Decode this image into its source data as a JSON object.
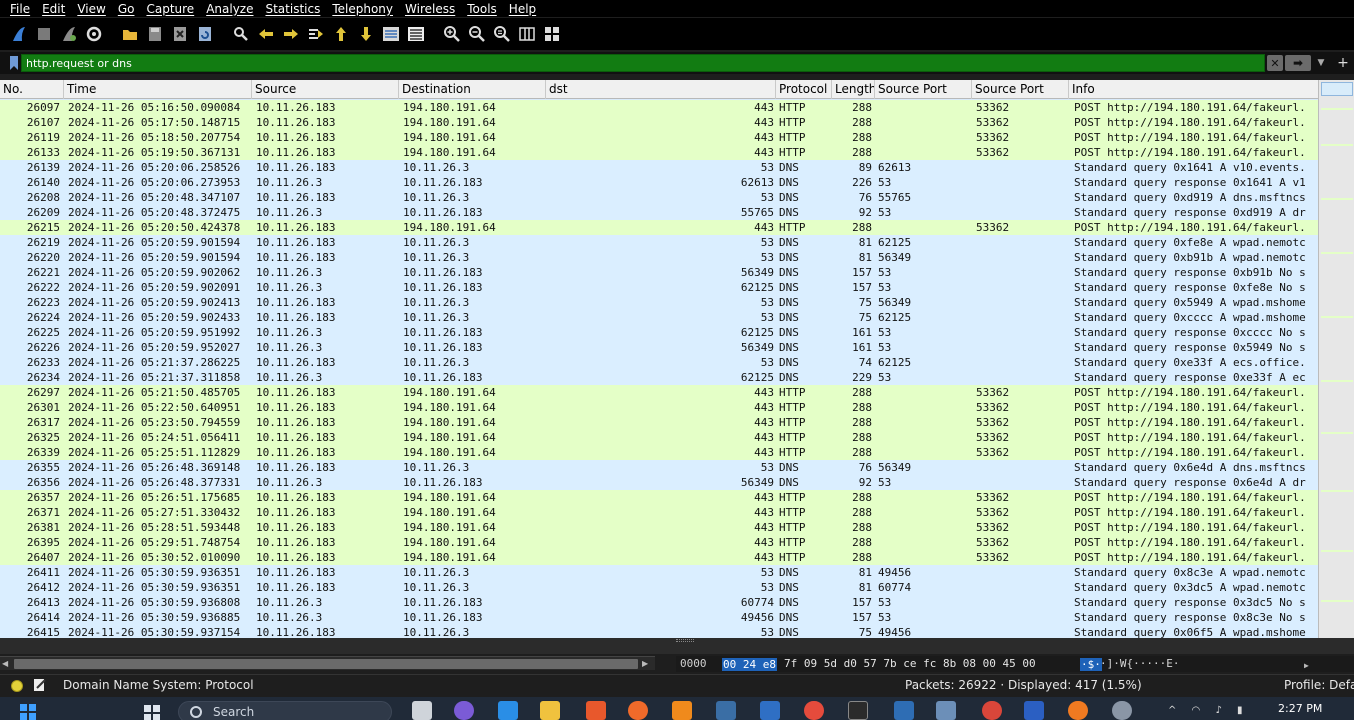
{
  "menu": [
    "File",
    "Edit",
    "View",
    "Go",
    "Capture",
    "Analyze",
    "Statistics",
    "Telephony",
    "Wireless",
    "Tools",
    "Help"
  ],
  "filter": {
    "value": "http.request or dns"
  },
  "columns": [
    "No.",
    "Time",
    "Source",
    "Destination",
    "dst",
    "Protocol",
    "Length",
    "Source Port",
    "Source Port",
    "Info"
  ],
  "colors": {
    "http_row": "#e4ffc7",
    "dns_row": "#daeeff",
    "filter_valid": "#127c12",
    "selection": "#1e62b8"
  },
  "rows": [
    {
      "no": "26097",
      "time": "2024-11-26 05:16:50.090084",
      "src": "10.11.26.183",
      "dst": "194.180.191.64",
      "dport": "443",
      "proto": "HTTP",
      "len": "288",
      "sport1": "",
      "sport2": "53362",
      "info": "POST http://194.180.191.64/fakeurl."
    },
    {
      "no": "26107",
      "time": "2024-11-26 05:17:50.148715",
      "src": "10.11.26.183",
      "dst": "194.180.191.64",
      "dport": "443",
      "proto": "HTTP",
      "len": "288",
      "sport1": "",
      "sport2": "53362",
      "info": "POST http://194.180.191.64/fakeurl."
    },
    {
      "no": "26119",
      "time": "2024-11-26 05:18:50.207754",
      "src": "10.11.26.183",
      "dst": "194.180.191.64",
      "dport": "443",
      "proto": "HTTP",
      "len": "288",
      "sport1": "",
      "sport2": "53362",
      "info": "POST http://194.180.191.64/fakeurl."
    },
    {
      "no": "26133",
      "time": "2024-11-26 05:19:50.367131",
      "src": "10.11.26.183",
      "dst": "194.180.191.64",
      "dport": "443",
      "proto": "HTTP",
      "len": "288",
      "sport1": "",
      "sport2": "53362",
      "info": "POST http://194.180.191.64/fakeurl."
    },
    {
      "no": "26139",
      "time": "2024-11-26 05:20:06.258526",
      "src": "10.11.26.183",
      "dst": "10.11.26.3",
      "dport": "53",
      "proto": "DNS",
      "len": "89",
      "sport1": "62613",
      "sport2": "",
      "info": "Standard query 0x1641 A v10.events."
    },
    {
      "no": "26140",
      "time": "2024-11-26 05:20:06.273953",
      "src": "10.11.26.3",
      "dst": "10.11.26.183",
      "dport": "62613",
      "proto": "DNS",
      "len": "226",
      "sport1": "53",
      "sport2": "",
      "info": "Standard query response 0x1641 A v1"
    },
    {
      "no": "26208",
      "time": "2024-11-26 05:20:48.347107",
      "src": "10.11.26.183",
      "dst": "10.11.26.3",
      "dport": "53",
      "proto": "DNS",
      "len": "76",
      "sport1": "55765",
      "sport2": "",
      "info": "Standard query 0xd919 A dns.msftncs"
    },
    {
      "no": "26209",
      "time": "2024-11-26 05:20:48.372475",
      "src": "10.11.26.3",
      "dst": "10.11.26.183",
      "dport": "55765",
      "proto": "DNS",
      "len": "92",
      "sport1": "53",
      "sport2": "",
      "info": "Standard query response 0xd919 A dr"
    },
    {
      "no": "26215",
      "time": "2024-11-26 05:20:50.424378",
      "src": "10.11.26.183",
      "dst": "194.180.191.64",
      "dport": "443",
      "proto": "HTTP",
      "len": "288",
      "sport1": "",
      "sport2": "53362",
      "info": "POST http://194.180.191.64/fakeurl."
    },
    {
      "no": "26219",
      "time": "2024-11-26 05:20:59.901594",
      "src": "10.11.26.183",
      "dst": "10.11.26.3",
      "dport": "53",
      "proto": "DNS",
      "len": "81",
      "sport1": "62125",
      "sport2": "",
      "info": "Standard query 0xfe8e A wpad.nemotc"
    },
    {
      "no": "26220",
      "time": "2024-11-26 05:20:59.901594",
      "src": "10.11.26.183",
      "dst": "10.11.26.3",
      "dport": "53",
      "proto": "DNS",
      "len": "81",
      "sport1": "56349",
      "sport2": "",
      "info": "Standard query 0xb91b A wpad.nemotc"
    },
    {
      "no": "26221",
      "time": "2024-11-26 05:20:59.902062",
      "src": "10.11.26.3",
      "dst": "10.11.26.183",
      "dport": "56349",
      "proto": "DNS",
      "len": "157",
      "sport1": "53",
      "sport2": "",
      "info": "Standard query response 0xb91b No s"
    },
    {
      "no": "26222",
      "time": "2024-11-26 05:20:59.902091",
      "src": "10.11.26.3",
      "dst": "10.11.26.183",
      "dport": "62125",
      "proto": "DNS",
      "len": "157",
      "sport1": "53",
      "sport2": "",
      "info": "Standard query response 0xfe8e No s"
    },
    {
      "no": "26223",
      "time": "2024-11-26 05:20:59.902413",
      "src": "10.11.26.183",
      "dst": "10.11.26.3",
      "dport": "53",
      "proto": "DNS",
      "len": "75",
      "sport1": "56349",
      "sport2": "",
      "info": "Standard query 0x5949 A wpad.mshome"
    },
    {
      "no": "26224",
      "time": "2024-11-26 05:20:59.902433",
      "src": "10.11.26.183",
      "dst": "10.11.26.3",
      "dport": "53",
      "proto": "DNS",
      "len": "75",
      "sport1": "62125",
      "sport2": "",
      "info": "Standard query 0xcccc A wpad.mshome"
    },
    {
      "no": "26225",
      "time": "2024-11-26 05:20:59.951992",
      "src": "10.11.26.3",
      "dst": "10.11.26.183",
      "dport": "62125",
      "proto": "DNS",
      "len": "161",
      "sport1": "53",
      "sport2": "",
      "info": "Standard query response 0xcccc No s"
    },
    {
      "no": "26226",
      "time": "2024-11-26 05:20:59.952027",
      "src": "10.11.26.3",
      "dst": "10.11.26.183",
      "dport": "56349",
      "proto": "DNS",
      "len": "161",
      "sport1": "53",
      "sport2": "",
      "info": "Standard query response 0x5949 No s"
    },
    {
      "no": "26233",
      "time": "2024-11-26 05:21:37.286225",
      "src": "10.11.26.183",
      "dst": "10.11.26.3",
      "dport": "53",
      "proto": "DNS",
      "len": "74",
      "sport1": "62125",
      "sport2": "",
      "info": "Standard query 0xe33f A ecs.office."
    },
    {
      "no": "26234",
      "time": "2024-11-26 05:21:37.311858",
      "src": "10.11.26.3",
      "dst": "10.11.26.183",
      "dport": "62125",
      "proto": "DNS",
      "len": "229",
      "sport1": "53",
      "sport2": "",
      "info": "Standard query response 0xe33f A ec"
    },
    {
      "no": "26297",
      "time": "2024-11-26 05:21:50.485705",
      "src": "10.11.26.183",
      "dst": "194.180.191.64",
      "dport": "443",
      "proto": "HTTP",
      "len": "288",
      "sport1": "",
      "sport2": "53362",
      "info": "POST http://194.180.191.64/fakeurl."
    },
    {
      "no": "26301",
      "time": "2024-11-26 05:22:50.640951",
      "src": "10.11.26.183",
      "dst": "194.180.191.64",
      "dport": "443",
      "proto": "HTTP",
      "len": "288",
      "sport1": "",
      "sport2": "53362",
      "info": "POST http://194.180.191.64/fakeurl."
    },
    {
      "no": "26317",
      "time": "2024-11-26 05:23:50.794559",
      "src": "10.11.26.183",
      "dst": "194.180.191.64",
      "dport": "443",
      "proto": "HTTP",
      "len": "288",
      "sport1": "",
      "sport2": "53362",
      "info": "POST http://194.180.191.64/fakeurl."
    },
    {
      "no": "26325",
      "time": "2024-11-26 05:24:51.056411",
      "src": "10.11.26.183",
      "dst": "194.180.191.64",
      "dport": "443",
      "proto": "HTTP",
      "len": "288",
      "sport1": "",
      "sport2": "53362",
      "info": "POST http://194.180.191.64/fakeurl."
    },
    {
      "no": "26339",
      "time": "2024-11-26 05:25:51.112829",
      "src": "10.11.26.183",
      "dst": "194.180.191.64",
      "dport": "443",
      "proto": "HTTP",
      "len": "288",
      "sport1": "",
      "sport2": "53362",
      "info": "POST http://194.180.191.64/fakeurl."
    },
    {
      "no": "26355",
      "time": "2024-11-26 05:26:48.369148",
      "src": "10.11.26.183",
      "dst": "10.11.26.3",
      "dport": "53",
      "proto": "DNS",
      "len": "76",
      "sport1": "56349",
      "sport2": "",
      "info": "Standard query 0x6e4d A dns.msftncs"
    },
    {
      "no": "26356",
      "time": "2024-11-26 05:26:48.377331",
      "src": "10.11.26.3",
      "dst": "10.11.26.183",
      "dport": "56349",
      "proto": "DNS",
      "len": "92",
      "sport1": "53",
      "sport2": "",
      "info": "Standard query response 0x6e4d A dr"
    },
    {
      "no": "26357",
      "time": "2024-11-26 05:26:51.175685",
      "src": "10.11.26.183",
      "dst": "194.180.191.64",
      "dport": "443",
      "proto": "HTTP",
      "len": "288",
      "sport1": "",
      "sport2": "53362",
      "info": "POST http://194.180.191.64/fakeurl."
    },
    {
      "no": "26371",
      "time": "2024-11-26 05:27:51.330432",
      "src": "10.11.26.183",
      "dst": "194.180.191.64",
      "dport": "443",
      "proto": "HTTP",
      "len": "288",
      "sport1": "",
      "sport2": "53362",
      "info": "POST http://194.180.191.64/fakeurl."
    },
    {
      "no": "26381",
      "time": "2024-11-26 05:28:51.593448",
      "src": "10.11.26.183",
      "dst": "194.180.191.64",
      "dport": "443",
      "proto": "HTTP",
      "len": "288",
      "sport1": "",
      "sport2": "53362",
      "info": "POST http://194.180.191.64/fakeurl."
    },
    {
      "no": "26395",
      "time": "2024-11-26 05:29:51.748754",
      "src": "10.11.26.183",
      "dst": "194.180.191.64",
      "dport": "443",
      "proto": "HTTP",
      "len": "288",
      "sport1": "",
      "sport2": "53362",
      "info": "POST http://194.180.191.64/fakeurl."
    },
    {
      "no": "26407",
      "time": "2024-11-26 05:30:52.010090",
      "src": "10.11.26.183",
      "dst": "194.180.191.64",
      "dport": "443",
      "proto": "HTTP",
      "len": "288",
      "sport1": "",
      "sport2": "53362",
      "info": "POST http://194.180.191.64/fakeurl."
    },
    {
      "no": "26411",
      "time": "2024-11-26 05:30:59.936351",
      "src": "10.11.26.183",
      "dst": "10.11.26.3",
      "dport": "53",
      "proto": "DNS",
      "len": "81",
      "sport1": "49456",
      "sport2": "",
      "info": "Standard query 0x8c3e A wpad.nemotc"
    },
    {
      "no": "26412",
      "time": "2024-11-26 05:30:59.936351",
      "src": "10.11.26.183",
      "dst": "10.11.26.3",
      "dport": "53",
      "proto": "DNS",
      "len": "81",
      "sport1": "60774",
      "sport2": "",
      "info": "Standard query 0x3dc5 A wpad.nemotc"
    },
    {
      "no": "26413",
      "time": "2024-11-26 05:30:59.936808",
      "src": "10.11.26.3",
      "dst": "10.11.26.183",
      "dport": "60774",
      "proto": "DNS",
      "len": "157",
      "sport1": "53",
      "sport2": "",
      "info": "Standard query response 0x3dc5 No s"
    },
    {
      "no": "26414",
      "time": "2024-11-26 05:30:59.936885",
      "src": "10.11.26.3",
      "dst": "10.11.26.183",
      "dport": "49456",
      "proto": "DNS",
      "len": "157",
      "sport1": "53",
      "sport2": "",
      "info": "Standard query response 0x8c3e No s"
    },
    {
      "no": "26415",
      "time": "2024-11-26 05:30:59.937154",
      "src": "10.11.26.183",
      "dst": "10.11.26.3",
      "dport": "53",
      "proto": "DNS",
      "len": "75",
      "sport1": "49456",
      "sport2": "",
      "info": "Standard query 0x06f5 A wpad.mshome"
    }
  ],
  "hex": {
    "offset": "0000",
    "selected": "00 24 e8",
    "rest": "7f 09 5d d0 57  7b ce fc 8b 08 00 45 00",
    "ascii_selected": "·$·",
    "ascii_rest": "·]·W{·····E·"
  },
  "status": {
    "field": "Domain Name System: Protocol",
    "packets": "Packets: 26922 · Displayed: 417 (1.5%)",
    "profile": "Profile: Defau"
  },
  "taskbar": {
    "search_placeholder": "Search",
    "time": "2:27 PM"
  }
}
